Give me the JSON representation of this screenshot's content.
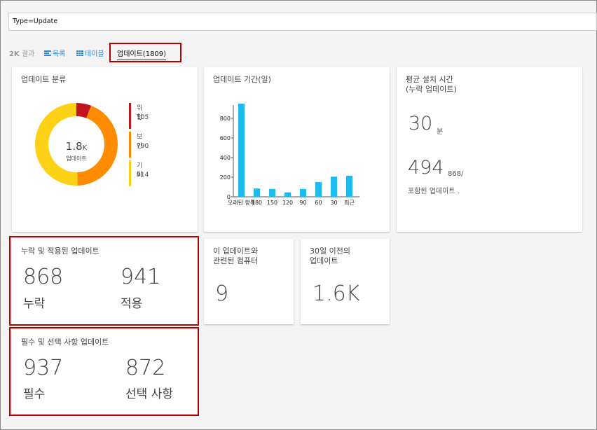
{
  "search": {
    "query": "Type=Update"
  },
  "viewbar": {
    "count": "2K",
    "count_label": "결과",
    "tabs": [
      {
        "label": "목록",
        "icon": "list-icon"
      },
      {
        "label": "테이블",
        "icon": "table-icon"
      },
      {
        "label": "업데이트(1809)",
        "icon": "grid-icon",
        "active": true
      }
    ]
  },
  "classification": {
    "title": "업데이트 분류",
    "center_value": "1.8",
    "center_unit": "K",
    "center_label": "업데이트",
    "segments": [
      {
        "label": "위험",
        "value": 105,
        "color": "#c0141f"
      },
      {
        "label": "보안",
        "value": 790,
        "color": "#ff8c00"
      },
      {
        "label": "기타",
        "value": 914,
        "color": "#fcd116"
      }
    ]
  },
  "age": {
    "title": "업데이트 기간(일)",
    "chart_data": {
      "type": "bar",
      "categories": [
        "오래된 항목",
        "180",
        "150",
        "120",
        "90",
        "60",
        "30",
        "최근"
      ],
      "values": [
        950,
        85,
        80,
        45,
        80,
        150,
        205,
        215
      ],
      "ylim": [
        0,
        1000
      ],
      "yticks": [
        0,
        200,
        400,
        600,
        800
      ],
      "color": "#1ebbee"
    }
  },
  "install_time": {
    "title_line1": "평균 설치 시간",
    "title_line2": "(누락 업데이트)",
    "minutes": "30",
    "minutes_unit": "분",
    "count": "494",
    "count_of": "868/",
    "count_label": "포함된 업데이트 ."
  },
  "missing_applied": {
    "title": "누락 및 적용된 업데이트",
    "missing_value": "868",
    "missing_label": "누락",
    "applied_value": "941",
    "applied_label": "적용"
  },
  "computers": {
    "title_line1": "이 업데이트와",
    "title_line2": "관련된 컴퓨터",
    "value": "9"
  },
  "older": {
    "title_line1": "30일 이전의",
    "title_line2": "업데이트",
    "value": "1.6K"
  },
  "required_optional": {
    "title": "필수 및 선택 사항 업데이트",
    "required_value": "937",
    "required_label": "필수",
    "optional_value": "872",
    "optional_label": "선택 사항"
  }
}
